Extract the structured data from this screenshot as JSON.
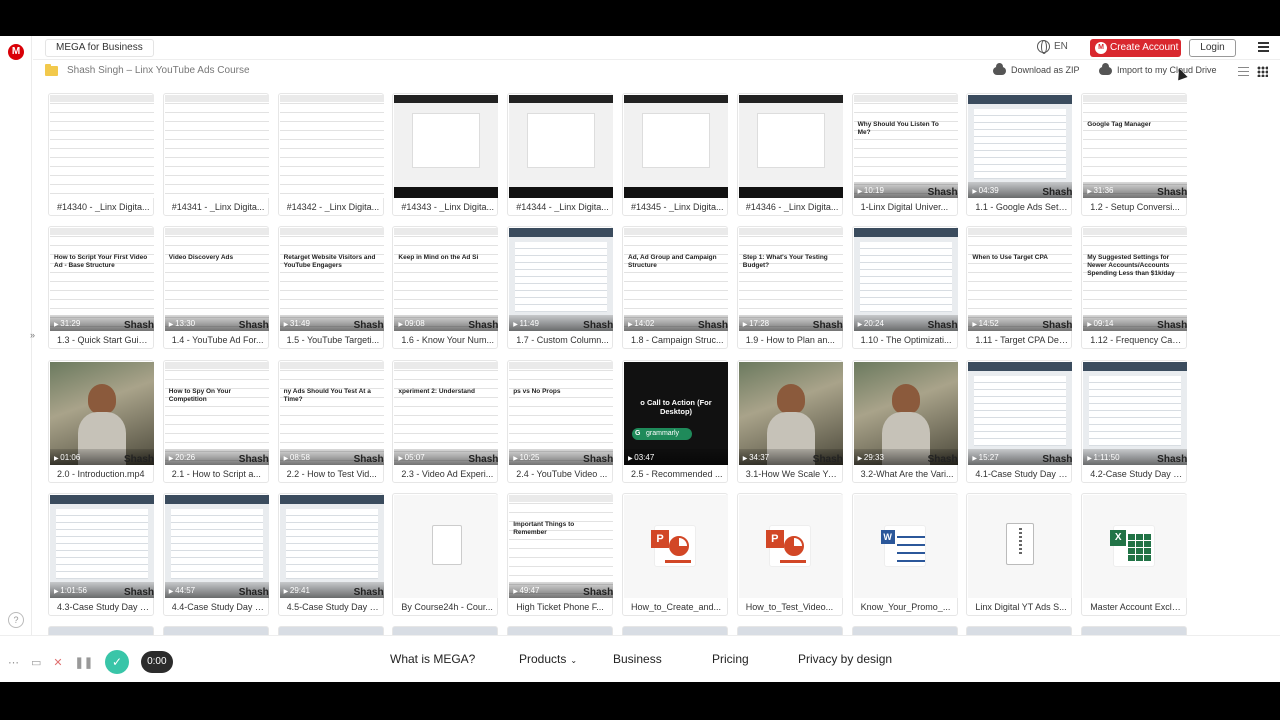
{
  "topbar": {
    "brand_tab": "MEGA for Business",
    "language": "EN",
    "create_account": "Create Account",
    "login": "Login"
  },
  "breadcrumb": {
    "folder_title": "Shash Singh – Linx YouTube Ads Course",
    "download_zip": "Download as ZIP",
    "import_cloud": "Import to my Cloud Drive"
  },
  "files": [
    {
      "name": "#14340 - _Linx Digita...",
      "kind": "sheet"
    },
    {
      "name": "#14341 - _Linx Digita...",
      "kind": "sheet"
    },
    {
      "name": "#14342 - _Linx Digita...",
      "kind": "sheet"
    },
    {
      "name": "#14343 - _Linx Digita...",
      "kind": "dark"
    },
    {
      "name": "#14344 - _Linx Digita...",
      "kind": "dark"
    },
    {
      "name": "#14345 - _Linx Digita...",
      "kind": "dark"
    },
    {
      "name": "#14346 - _Linx Digita...",
      "kind": "dark"
    },
    {
      "name": "1-Linx Digital Univer...",
      "kind": "slide",
      "duration": "10:19",
      "heading": "Why Should You Listen To Me?"
    },
    {
      "name": "1.1 - Google Ads Setu...",
      "kind": "video",
      "duration": "04:39"
    },
    {
      "name": "1.2 - Setup Conversi...",
      "kind": "slide",
      "duration": "31:36",
      "heading": "Google Tag Manager"
    },
    {
      "name": "1.3 - Quick Start Guid...",
      "kind": "slide",
      "duration": "31:29",
      "heading": "How to Script Your First Video Ad - Base Structure"
    },
    {
      "name": "1.4 - YouTube Ad For...",
      "kind": "slide",
      "duration": "13:30",
      "heading": "Video Discovery Ads"
    },
    {
      "name": "1.5 - YouTube Targeti...",
      "kind": "slide",
      "duration": "31:49",
      "heading": "Retarget Website Visitors and YouTube Engagers"
    },
    {
      "name": "1.6 - Know Your Num...",
      "kind": "slide",
      "duration": "09:08",
      "heading": "Keep in Mind on the Ad Si"
    },
    {
      "name": "1.7 - Custom Column...",
      "kind": "video",
      "duration": "11:49"
    },
    {
      "name": "1.8 - Campaign Struc...",
      "kind": "slide",
      "duration": "14:02",
      "heading": "Ad, Ad Group and Campaign Structure"
    },
    {
      "name": "1.9 - How to Plan an...",
      "kind": "slide",
      "duration": "17:28",
      "heading": "Step 1: What's Your Testing Budget?"
    },
    {
      "name": "1.10 - The Optimizati...",
      "kind": "video",
      "duration": "20:24"
    },
    {
      "name": "1.11 - Target CPA Dee...",
      "kind": "slide",
      "duration": "14:52",
      "heading": "When to Use Target CPA"
    },
    {
      "name": "1.12 - Frequency Cap...",
      "kind": "slide",
      "duration": "09:14",
      "heading": "My Suggested Settings for Newer Accounts/Accounts Spending Less than $1k/day"
    },
    {
      "name": "2.0 - Introduction.mp4",
      "kind": "scene",
      "duration": "01:06"
    },
    {
      "name": "2.1 - How to Script a...",
      "kind": "slide",
      "duration": "20:26",
      "heading": "How to Spy On Your Competition"
    },
    {
      "name": "2.2 - How to Test Vid...",
      "kind": "slide",
      "duration": "08:58",
      "heading": "ny Ads Should You Test At a Time?"
    },
    {
      "name": "2.3 - Video Ad Experi...",
      "kind": "slide",
      "duration": "05:07",
      "heading": "xperiment 2: Understand"
    },
    {
      "name": "2.4 - YouTube Video ...",
      "kind": "slide",
      "duration": "10:25",
      "heading": "ps vs No Props"
    },
    {
      "name": "2.5 - Recommended ...",
      "kind": "cta",
      "duration": "03:47",
      "heading": "o Call to Action (For Desktop)",
      "badge": "grammarly"
    },
    {
      "name": "3.1-How We Scale Yo...",
      "kind": "scene",
      "duration": "34:37"
    },
    {
      "name": "3.2-What Are the Vari...",
      "kind": "scene",
      "duration": "29:33"
    },
    {
      "name": "4.1-Case Study Day 1...",
      "kind": "video",
      "duration": "15:27"
    },
    {
      "name": "4.2-Case Study Day 1...",
      "kind": "video",
      "duration": "1:11:50"
    },
    {
      "name": "4.3-Case Study Day 2...",
      "kind": "video",
      "duration": "1:01:56"
    },
    {
      "name": "4.4-Case Study Day 3...",
      "kind": "video",
      "duration": "44:57"
    },
    {
      "name": "4.5-Case Study Day 4...",
      "kind": "video",
      "duration": "29:41"
    },
    {
      "name": "By Course24h - Cour...",
      "kind": "file"
    },
    {
      "name": "High Ticket Phone F...",
      "kind": "slide",
      "duration": "49:47",
      "heading": "Important Things to Remember"
    },
    {
      "name": "How_to_Create_and...",
      "kind": "ppt"
    },
    {
      "name": "How_to_Test_Video...",
      "kind": "ppt"
    },
    {
      "name": "Know_Your_Promo_...",
      "kind": "doc"
    },
    {
      "name": "Linx Digital YT Ads S...",
      "kind": "zip"
    },
    {
      "name": "Master Account Exclu...",
      "kind": "xls"
    }
  ],
  "watermark": "Shash",
  "footer": {
    "what_is_mega": "What is MEGA?",
    "products": "Products",
    "business": "Business",
    "pricing": "Pricing",
    "privacy": "Privacy by design"
  },
  "recorder": {
    "timer": "0:00"
  },
  "icons": {
    "logo": "M",
    "rail_toggle": "»",
    "help": "?"
  }
}
